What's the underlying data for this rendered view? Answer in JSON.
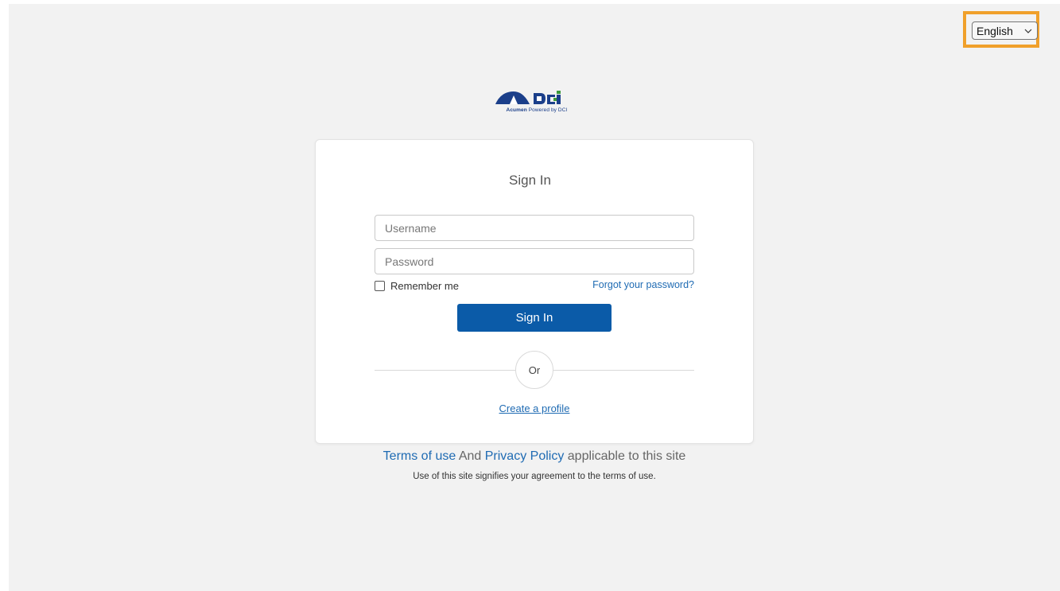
{
  "language": {
    "selected": "English",
    "highlight_color": "#f0a02b"
  },
  "logo": {
    "brand": "Acumen",
    "powered": "Powered by DCI",
    "icon": "acumen-dci-logo-icon"
  },
  "signin": {
    "title": "Sign In",
    "username_placeholder": "Username",
    "password_placeholder": "Password",
    "remember_label": "Remember me",
    "forgot_label": "Forgot your password?",
    "button_label": "Sign In",
    "or_label": "Or",
    "create_profile_label": "Create a profile",
    "button_color": "#0b5ba8"
  },
  "footer": {
    "terms_label": "Terms of use",
    "and_text": "And",
    "privacy_label": "Privacy Policy",
    "applicable_text": "applicable to this site",
    "notice": "Use of this site signifies your agreement to the terms of use."
  }
}
